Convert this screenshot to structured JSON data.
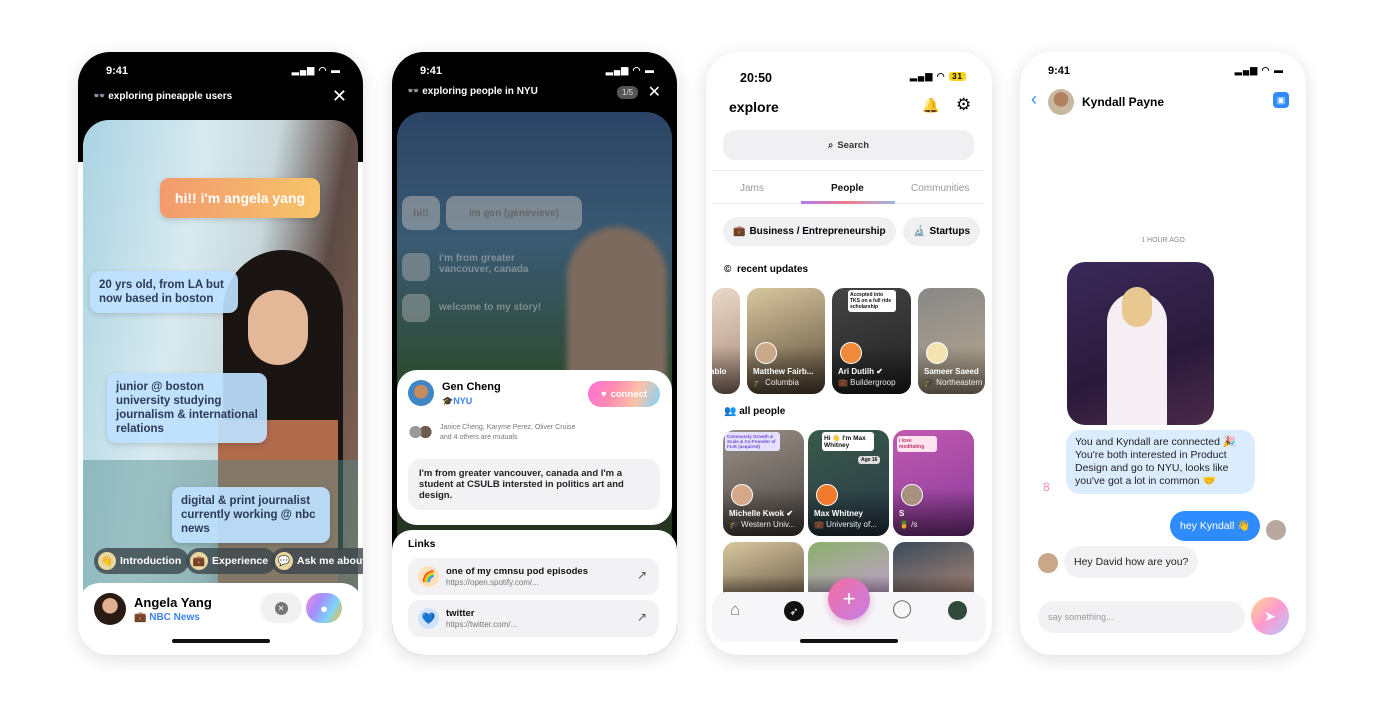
{
  "phone1": {
    "status_time": "9:41",
    "header": "exploring pineapple users",
    "bubbles": [
      "hi!! i'm angela yang",
      "20 yrs old, from LA but now based in boston",
      "junior @ boston university studying journalism & international relations",
      "digital & print journalist currently working @ nbc news"
    ],
    "chips": [
      {
        "icon": "👋",
        "label": "Introduction"
      },
      {
        "icon": "💼",
        "label": "Experience"
      },
      {
        "icon": "💬",
        "label": "Ask me about"
      }
    ],
    "name": "Angela Yang",
    "work": "NBC News",
    "work_icon": "💼",
    "accent": "#3b82f6"
  },
  "phone2": {
    "status_time": "9:41",
    "header": "exploring people in NYU",
    "counter": "1/5",
    "story_pills": [
      "hi!!",
      "im gen (genevieve)"
    ],
    "story_lines": [
      "i'm from greater vancouver, canada",
      "welcome to my story!"
    ],
    "name": "Gen Cheng",
    "school": "NYU",
    "school_icon": "🎓",
    "connect_label": "connect",
    "mutuals_line1": "Janice Cheng, Karyme Perez, Oliver Cruise",
    "mutuals_line2": "and 4 others are mutuals",
    "bio": "I'm from greater vancouver, canada and I'm a student at CSULB intersted in politics art and design.",
    "links_title": "Links",
    "links": [
      {
        "icon": "🌈",
        "title": "one of my cmnsu pod episodes",
        "url": "https://open.spotify.com/..."
      },
      {
        "icon": "💙",
        "title": "twitter",
        "url": "https://twitter.com/..."
      }
    ]
  },
  "phone3": {
    "status_time": "20:50",
    "battery": "31",
    "title": "explore",
    "search_placeholder": "Search",
    "tabs": [
      "Jams",
      "People",
      "Communities"
    ],
    "active_tab": "People",
    "filters": [
      {
        "icon": "💼",
        "label": "Business / Entrepreneurship"
      },
      {
        "icon": "🔬",
        "label": "Startups"
      }
    ],
    "recent_title": "recent updates",
    "recent": [
      {
        "name": "ablo",
        "sub": ""
      },
      {
        "name": "Matthew Fairb...",
        "sub": "🎓 Columbia"
      },
      {
        "name": "Ari Dutilh ✔",
        "sub": "💼 Buildergroop",
        "caption": "Accepted into TKS on a full ride scholarship"
      },
      {
        "name": "Sameer Saeed",
        "sub": "🎓 Northeastern"
      }
    ],
    "all_title": "all people",
    "people": [
      {
        "name": "Michelle Kwok ✔",
        "sub": "🎓 Western Univ...",
        "caption": "Community Growth & Scale & Co-Founder of FLIK (acquired)"
      },
      {
        "name": "Max Whitney",
        "sub": "💼 University of...",
        "caption": "Hi 👋 I'm Max Whitney",
        "tag": "Age 16"
      },
      {
        "name": "S",
        "sub": "🍍 /s",
        "caption": "i love meditating"
      }
    ]
  },
  "phone4": {
    "status_time": "9:41",
    "contact_name": "Kyndall Payne",
    "timestamp": "1 HOUR AGO",
    "system_message": "You and Kyndall are connected 🎉 You're both interested in Product Design and go to NYU, looks like you've got a lot in common 🤝",
    "sent_message": "hey Kyndall 👋",
    "received_message": "Hey David how are you?",
    "input_placeholder": "say something...",
    "accent": "#2f8cff"
  }
}
